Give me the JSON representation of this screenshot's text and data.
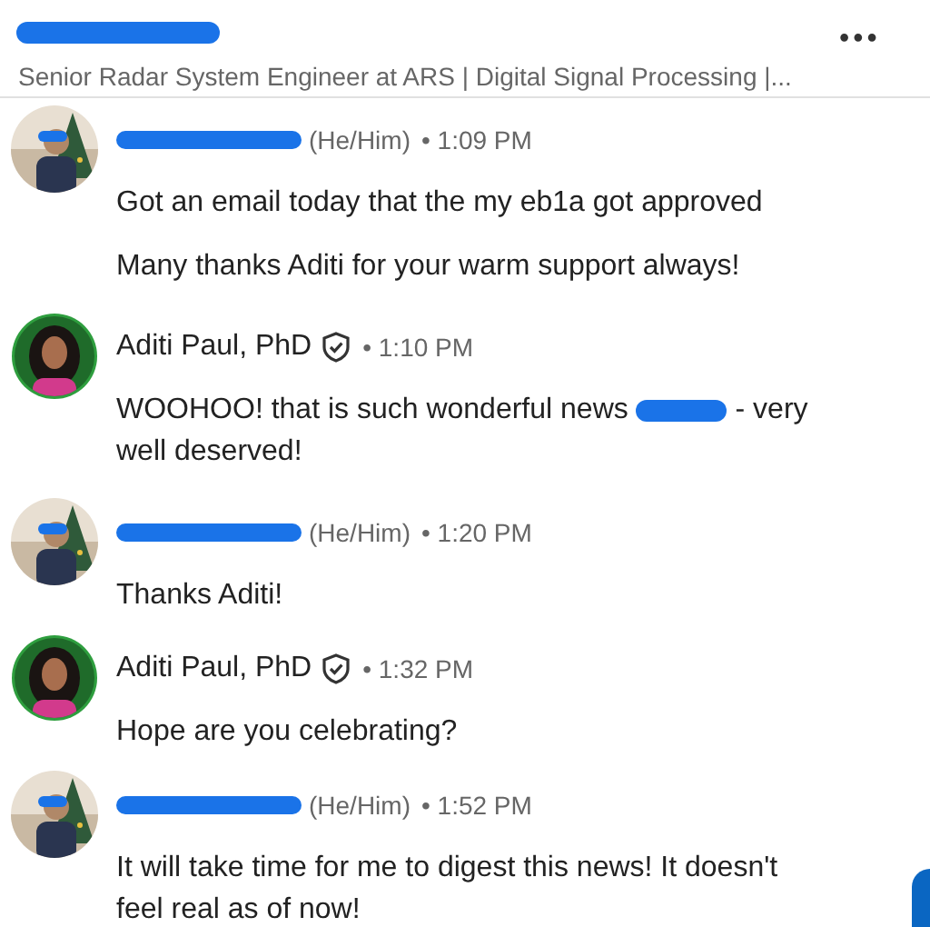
{
  "header": {
    "name_redacted": true,
    "subtitle": "Senior Radar System Engineer at ARS | Digital Signal Processing |...",
    "menu": "•••"
  },
  "messages": [
    {
      "sender": {
        "redacted": true,
        "pronouns": "(He/Him)"
      },
      "time": "• 1:09 PM",
      "paragraphs": [
        [
          {
            "kind": "text",
            "text": "Got an email today that the my eb1a got approved"
          }
        ],
        [
          {
            "kind": "text",
            "text": "Many thanks Aditi for your warm support always!"
          }
        ]
      ]
    },
    {
      "sender": {
        "redacted": false,
        "name": "Aditi Paul, PhD",
        "verified": true
      },
      "time": "• 1:10 PM",
      "paragraphs": [
        [
          {
            "kind": "text",
            "text": "WOOHOO! that is such wonderful news"
          },
          {
            "kind": "redaction"
          },
          {
            "kind": "text",
            "text": "- very"
          },
          {
            "kind": "text",
            "text": "well deserved!"
          }
        ]
      ]
    },
    {
      "sender": {
        "redacted": true,
        "pronouns": "(He/Him)"
      },
      "time": "• 1:20 PM",
      "paragraphs": [
        [
          {
            "kind": "text",
            "text": "Thanks Aditi!"
          }
        ]
      ]
    },
    {
      "sender": {
        "redacted": false,
        "name": "Aditi Paul, PhD",
        "verified": true
      },
      "time": "• 1:32 PM",
      "paragraphs": [
        [
          {
            "kind": "text",
            "text": "Hope are you celebrating?"
          }
        ]
      ]
    },
    {
      "sender": {
        "redacted": true,
        "pronouns": "(He/Him)"
      },
      "time": "• 1:52 PM",
      "paragraphs": [
        [
          {
            "kind": "text",
            "text": "It will take time for me to digest this news! It doesn't feel real as of now!"
          }
        ]
      ]
    }
  ]
}
